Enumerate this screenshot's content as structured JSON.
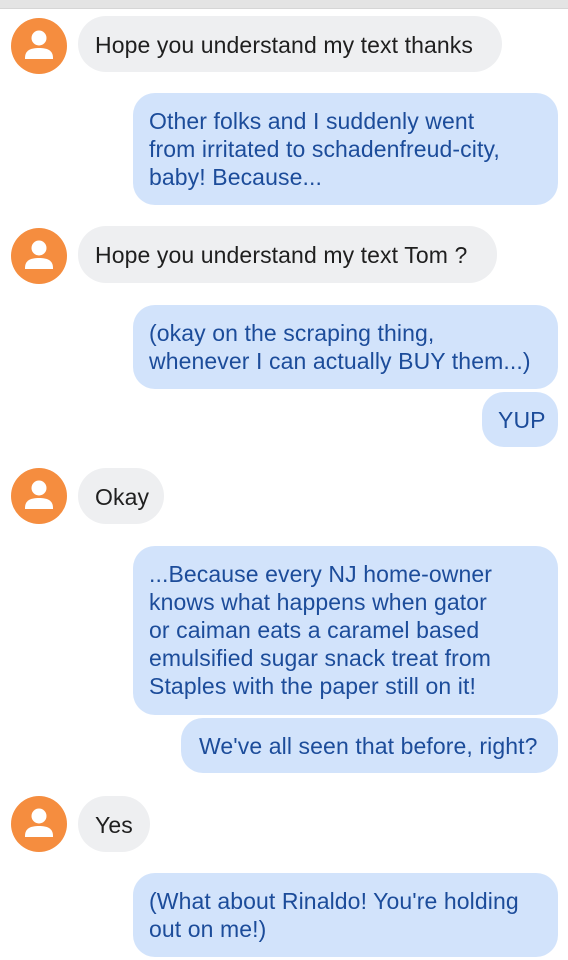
{
  "messages": [
    {
      "dir": "in",
      "text": "Hope you understand my text thanks"
    },
    {
      "dir": "out",
      "lines": [
        "Other folks and I suddenly went",
        "from irritated to schadenfreud-city,",
        "baby!  Because..."
      ]
    },
    {
      "dir": "in",
      "text": "Hope you understand my text Tom ?"
    },
    {
      "dir": "out",
      "lines": [
        "(okay on the scraping thing,",
        "whenever I can actually BUY them...)"
      ]
    },
    {
      "dir": "out",
      "lines": [
        "YUP"
      ]
    },
    {
      "dir": "in",
      "text": "Okay"
    },
    {
      "dir": "out",
      "lines": [
        "...Because every NJ home-owner",
        "knows what happens when gator",
        "or caiman eats a caramel based",
        "emulsified sugar snack treat from",
        "Staples with the paper still on it!"
      ]
    },
    {
      "dir": "out",
      "lines": [
        "We've all seen that before, right?"
      ]
    },
    {
      "dir": "in",
      "text": "Yes"
    },
    {
      "dir": "out",
      "lines": [
        "(What about Rinaldo!  You're holding",
        "out on me!)"
      ]
    }
  ],
  "colors": {
    "incoming_bubble": "#eeeff1",
    "outgoing_bubble": "#d2e3fb",
    "outgoing_text": "#1c4c9a",
    "avatar": "#f58d3f"
  },
  "icons": {
    "avatar": "person-icon"
  }
}
